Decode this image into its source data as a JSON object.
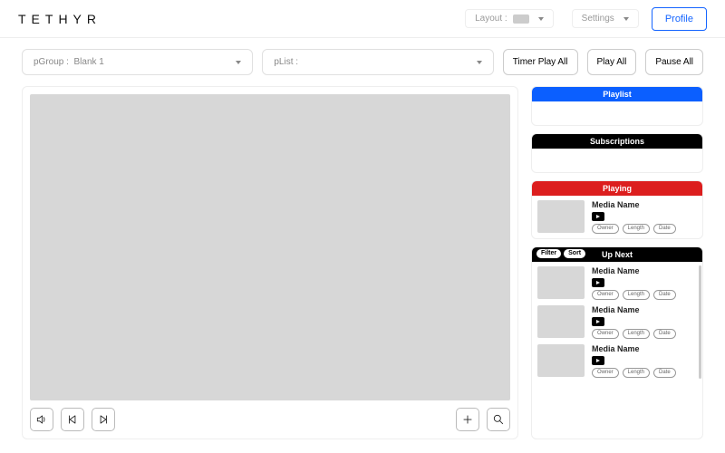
{
  "header": {
    "brand": "TETHYR",
    "layout_label": "Layout :",
    "settings_label": "Settings",
    "profile_label": "Profile"
  },
  "toolbar": {
    "pgroup_label": "pGroup :",
    "pgroup_value": "Blank 1",
    "plist_label": "pList :",
    "plist_value": "",
    "btn_timer_play_all": "Timer Play All",
    "btn_play_all": "Play All",
    "btn_pause_all": "Pause All"
  },
  "panels": {
    "playlist": {
      "title": "Playlist"
    },
    "subscriptions": {
      "title": "Subscriptions"
    },
    "playing": {
      "title": "Playing",
      "item": {
        "name": "Media Name",
        "badges": [
          "Owner",
          "Length",
          "Date"
        ]
      }
    },
    "upnext": {
      "title": "Up Next",
      "filter_label": "Filter",
      "sort_label": "Sort",
      "items": [
        {
          "name": "Media Name",
          "badges": [
            "Owner",
            "Length",
            "Date"
          ]
        },
        {
          "name": "Media Name",
          "badges": [
            "Owner",
            "Length",
            "Date"
          ]
        },
        {
          "name": "Media Name",
          "badges": [
            "Owner",
            "Length",
            "Date"
          ]
        }
      ]
    }
  }
}
